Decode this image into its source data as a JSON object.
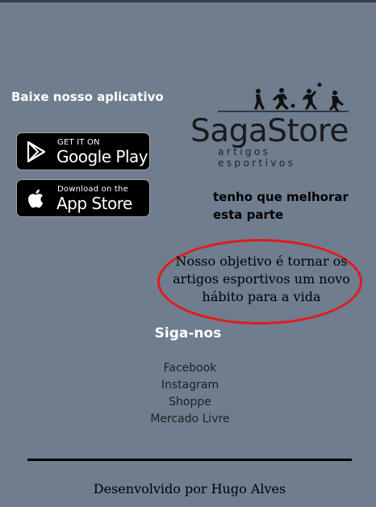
{
  "download": {
    "title": "Baixe nosso aplicativo",
    "google_play": {
      "small": "GET IT ON",
      "big": "Google Play"
    },
    "app_store": {
      "small": "Download on the",
      "big": "App Store"
    }
  },
  "logo": {
    "name": "SagaStore",
    "tagline": "artigos esportivos"
  },
  "note": {
    "line1": "tenho que melhorar",
    "line2": "esta parte"
  },
  "mission": {
    "line1": "Nosso objetivo é tornar os",
    "line2": "artigos esportivos um novo",
    "line3": "hábito para a vida"
  },
  "follow": {
    "title": "Siga-nos",
    "links": [
      "Facebook",
      "Instagram",
      "Shoppe",
      "Mercado Livre"
    ]
  },
  "footer": {
    "credit": "Desenvolvido por Hugo Alves"
  },
  "colors": {
    "background": "#6f7d8f",
    "highlight_ellipse": "#e11b1b"
  }
}
